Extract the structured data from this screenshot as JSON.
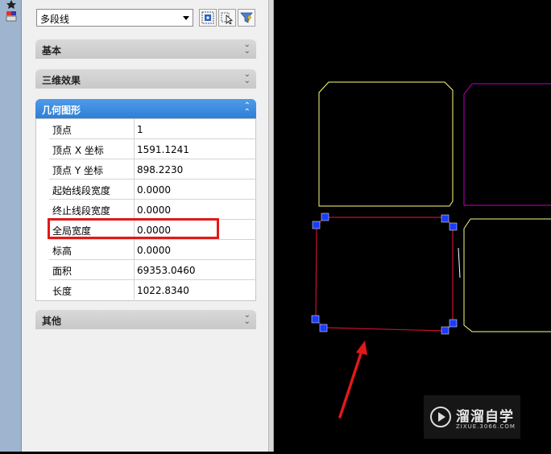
{
  "object_type_selector": {
    "value": "多段线"
  },
  "toolbar": {
    "buttons": [
      {
        "icon": "select-objects-icon"
      },
      {
        "icon": "quick-select-icon"
      },
      {
        "icon": "pickadd-toggle-icon"
      }
    ]
  },
  "sections": {
    "basic": {
      "label": "基本"
    },
    "3d_effects": {
      "label": "三维效果"
    },
    "geometry": {
      "label": "几何图形"
    },
    "other": {
      "label": "其他"
    }
  },
  "geometry_rows": [
    {
      "key": "顶点",
      "value": "1"
    },
    {
      "key": "顶点 X 坐标",
      "value": "1591.1241"
    },
    {
      "key": "顶点 Y 坐标",
      "value": "898.2230"
    },
    {
      "key": "起始线段宽度",
      "value": "0.0000"
    },
    {
      "key": "终止线段宽度",
      "value": "0.0000"
    },
    {
      "key": "全局宽度",
      "value": "0.0000"
    },
    {
      "key": "标高",
      "value": "0.0000"
    },
    {
      "key": "面积",
      "value": "69353.0460"
    },
    {
      "key": "长度",
      "value": "1022.8340"
    }
  ],
  "highlighted_row": "全局宽度",
  "watermark": {
    "brand": "溜溜自学",
    "url": "ZIXUE.3066.COM"
  },
  "colors": {
    "accent": "#2f7fd6",
    "highlight": "#e21818",
    "grip": "#1a3cff",
    "polyline_selected": "#c8102e",
    "polyline_yellow": "#ffff7f",
    "polyline_magenta": "#c000c0"
  }
}
